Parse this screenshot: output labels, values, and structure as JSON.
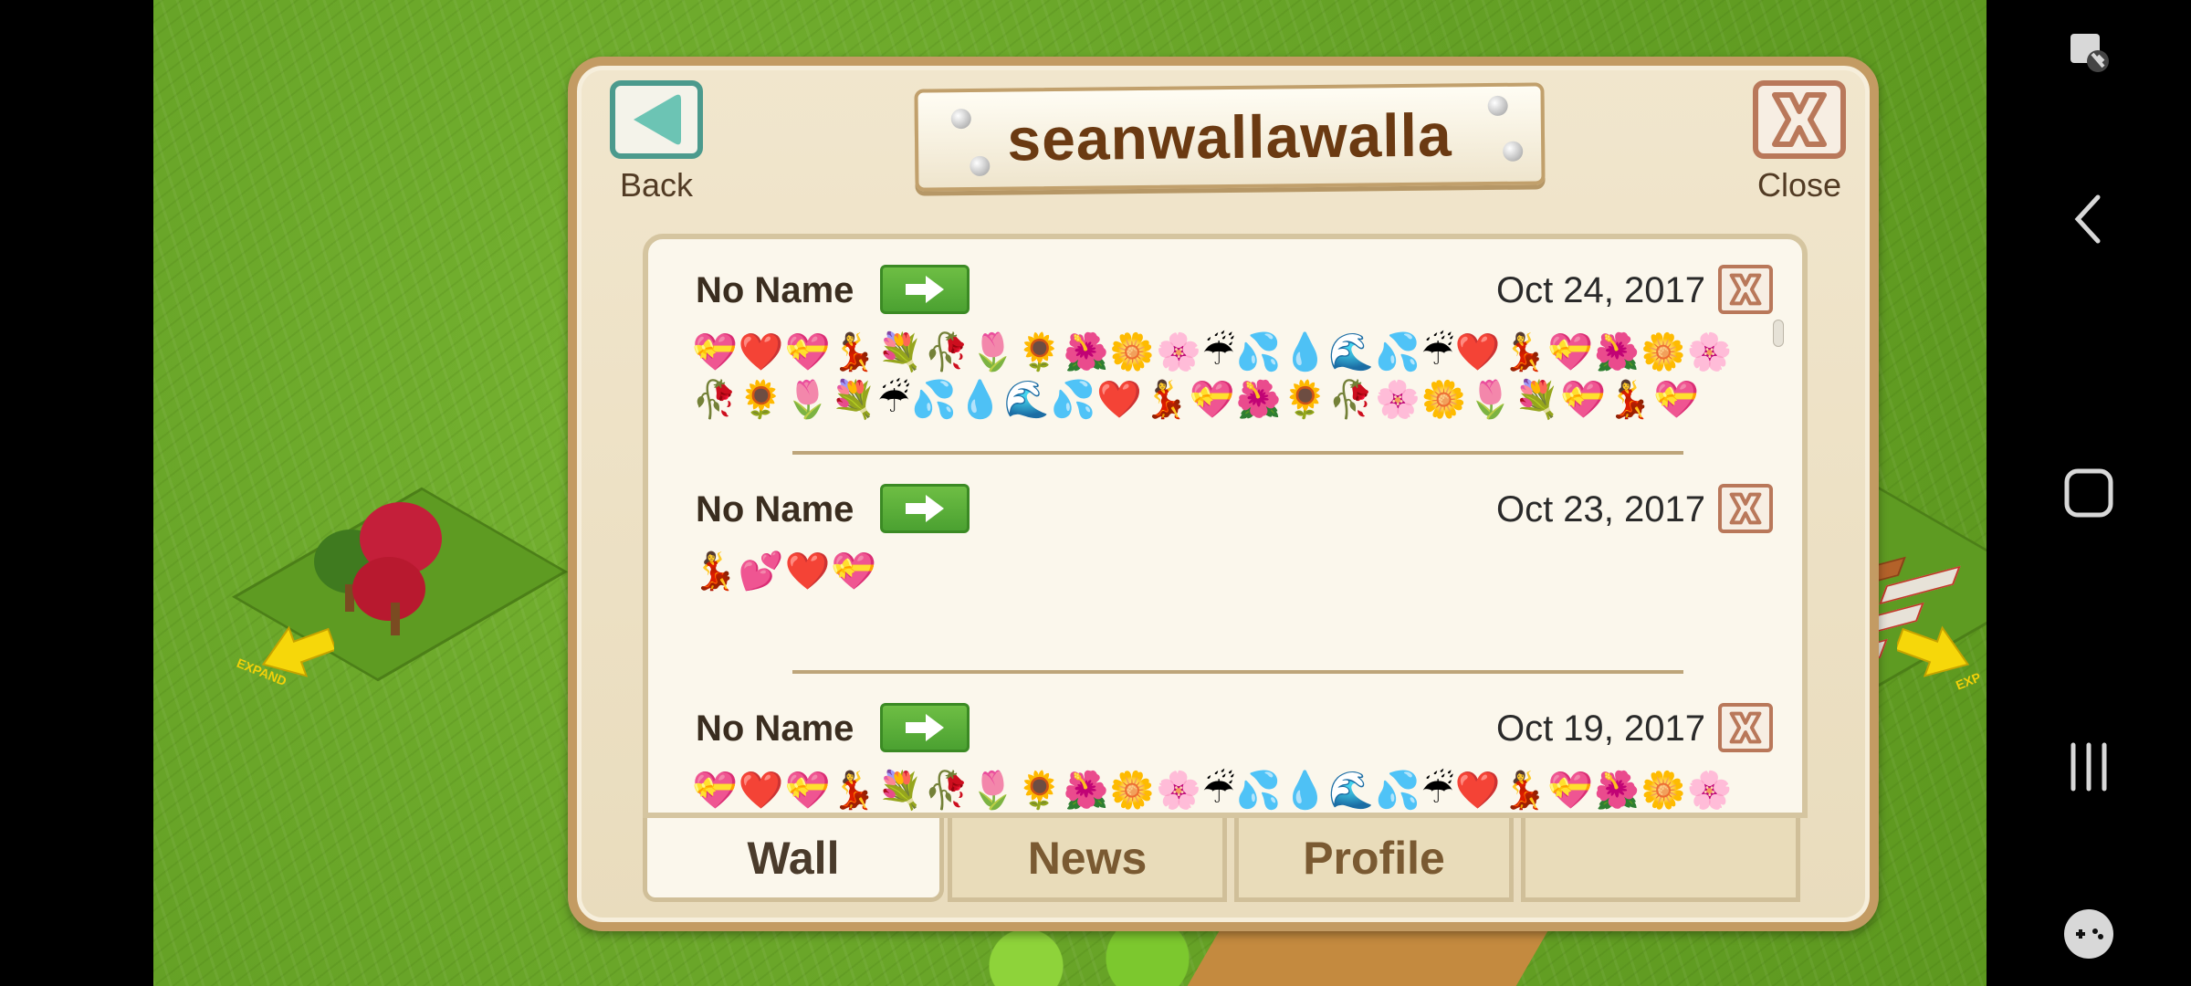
{
  "dialog": {
    "title": "seanwallawalla",
    "back_label": "Back",
    "close_label": "Close"
  },
  "posts": [
    {
      "name": "No Name",
      "date": "Oct 24, 2017",
      "message": "💝❤️💝💃💐🥀🌷🌻🌺🌼🌸☔💦💧🌊💦☔❤️💃💝🌺🌼🌸🥀🌻🌷💐☔💦💧🌊💦❤️💃💝🌺🌻🥀🌸🌼🌷💐💝💃💝"
    },
    {
      "name": "No Name",
      "date": "Oct 23, 2017",
      "message": "💃💕❤️💝"
    },
    {
      "name": "No Name",
      "date": "Oct 19, 2017",
      "message": "💝❤️💝💃💐🥀🌷🌻🌺🌼🌸☔💦💧🌊💦☔❤️💃💝🌺🌼🌸"
    }
  ],
  "tabs": {
    "wall": "Wall",
    "news": "News",
    "profile": "Profile",
    "active": "Wall"
  },
  "game": {
    "left_expand_label": "EXPAND",
    "right_expand_label": "EXP"
  },
  "colors": {
    "grass": "#6aa62a",
    "dialog_border": "#c39b63",
    "back_button": "#4b9a8d",
    "close_button": "#b9785a",
    "go_button": "#4ba131",
    "title_text": "#6b3a12"
  },
  "icons": {
    "back": "left-triangle-icon",
    "close": "x-icon",
    "go": "right-arrow-icon",
    "delete": "x-icon"
  }
}
